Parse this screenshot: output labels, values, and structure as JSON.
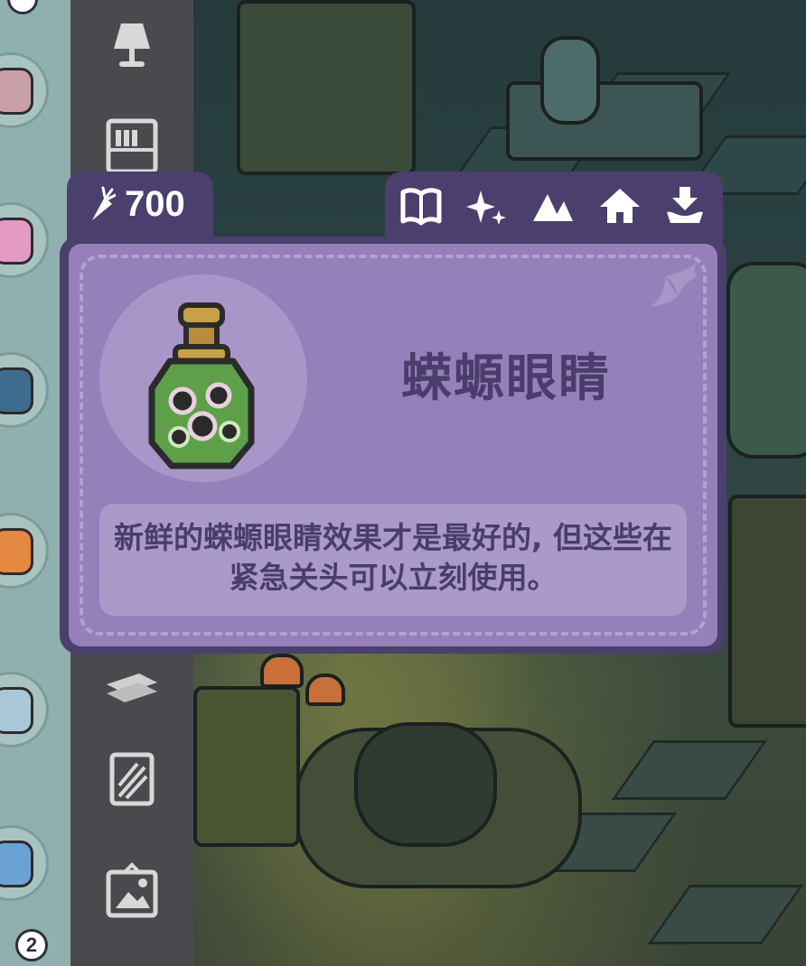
{
  "currency": {
    "icon": "carrot-icon",
    "amount": "700"
  },
  "toolbar": {
    "tabs": [
      {
        "icon": "book-icon",
        "label": ""
      },
      {
        "icon": "sparkles-icon",
        "label": ""
      },
      {
        "icon": "mountains-icon",
        "label": ""
      },
      {
        "icon": "house-icon",
        "label": ""
      },
      {
        "icon": "download-tray-icon",
        "label": ""
      }
    ]
  },
  "item": {
    "name": "蝾螈眼睛",
    "icon": "newt-eye-potion-icon",
    "description": "新鲜的蝾螈眼睛效果才是最好的, 但这些在紧急关头可以立刻使用。"
  },
  "inventory": {
    "badge_count": "2"
  },
  "sidebar": {
    "categories": [
      {
        "icon": "lamp-icon"
      },
      {
        "icon": "bookshelf-icon"
      },
      {
        "icon": "wood-planks-icon"
      },
      {
        "icon": "wallpaper-icon"
      },
      {
        "icon": "picture-frame-icon"
      }
    ]
  },
  "colors": {
    "panel_dark": "#4b3f6e",
    "panel_fill": "#9580b9",
    "text": "#4a3d6b",
    "sidebar": "#4a4a4e",
    "inventory_strip": "#8fb0ae"
  }
}
